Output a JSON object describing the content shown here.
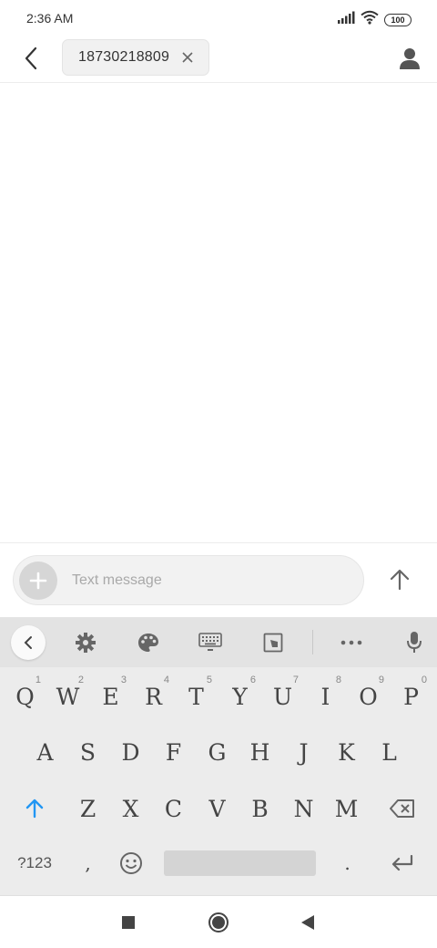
{
  "status_bar": {
    "time": "2:36 AM",
    "battery": "100",
    "signal_icon": "signal-bars-icon",
    "wifi_icon": "wifi-icon"
  },
  "header": {
    "back_icon": "chevron-left-icon",
    "recipient": "18730218809",
    "chip_close_icon": "close-icon",
    "contact_icon": "person-icon"
  },
  "compose": {
    "attach_icon": "plus-icon",
    "placeholder": "Text message",
    "value": "",
    "send_icon": "arrow-up-icon"
  },
  "keyboard": {
    "toolbar": [
      "chevron-left-icon",
      "gear-icon",
      "palette-icon",
      "keyboard-icon",
      "resize-icon",
      "more-icon",
      "mic-icon"
    ],
    "row1": [
      {
        "label": "Q",
        "hint": "1"
      },
      {
        "label": "W",
        "hint": "2"
      },
      {
        "label": "E",
        "hint": "3"
      },
      {
        "label": "R",
        "hint": "4"
      },
      {
        "label": "T",
        "hint": "5"
      },
      {
        "label": "Y",
        "hint": "6"
      },
      {
        "label": "U",
        "hint": "7"
      },
      {
        "label": "I",
        "hint": "8"
      },
      {
        "label": "O",
        "hint": "9"
      },
      {
        "label": "P",
        "hint": "0"
      }
    ],
    "row2": [
      "A",
      "S",
      "D",
      "F",
      "G",
      "H",
      "J",
      "K",
      "L"
    ],
    "row3": [
      "Z",
      "X",
      "C",
      "V",
      "B",
      "N",
      "M"
    ],
    "symbols_label": "?123",
    "comma": ",",
    "period": ".",
    "shift_icon": "shift-arrow-icon",
    "backspace_icon": "backspace-icon",
    "emoji_icon": "emoji-icon",
    "enter_icon": "enter-icon",
    "accent_color": "#2196f3"
  },
  "nav_bar": [
    "recents-square-icon",
    "home-circle-icon",
    "back-triangle-icon"
  ]
}
